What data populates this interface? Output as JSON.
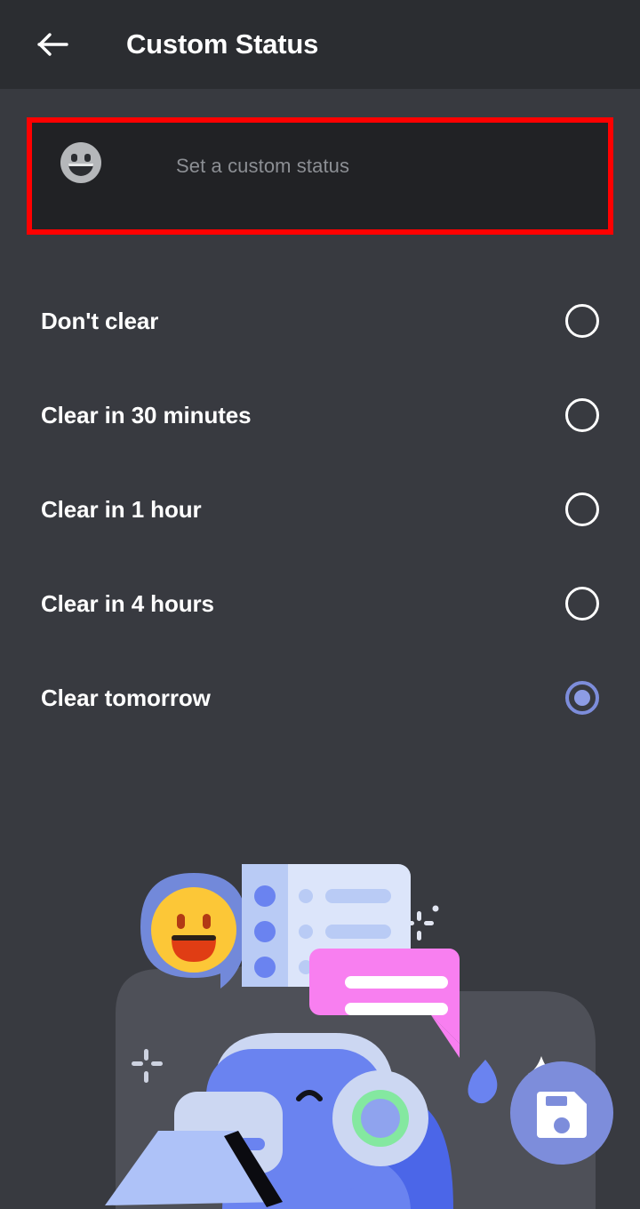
{
  "header": {
    "title": "Custom Status",
    "back_icon": "arrow-left-icon"
  },
  "status_input": {
    "placeholder": "Set a custom status",
    "value": "",
    "emoji_icon": "grinning-face-icon",
    "highlight_color": "#ff0000",
    "background_color": "#212225"
  },
  "clear_after": {
    "selected": "Clear tomorrow",
    "options": [
      {
        "label": "Don't clear",
        "selected": false
      },
      {
        "label": "Clear in 30 minutes",
        "selected": false
      },
      {
        "label": "Clear in 1 hour",
        "selected": false
      },
      {
        "label": "Clear in 4 hours",
        "selected": false
      },
      {
        "label": "Clear tomorrow",
        "selected": true
      }
    ],
    "selected_color": "#7d8ddb",
    "unselected_color": "#ffffff"
  },
  "illustration": {
    "name": "wumpus-custom-status-illustration",
    "elements": [
      "emoji-pin-icon",
      "list-card-icon",
      "speech-bubble-icon",
      "wumpus-with-headset-icon",
      "laptop-icon",
      "sparkle-icon",
      "save-fab-button"
    ],
    "blob_color": "#4e5058",
    "accent_periwinkle": "#7289da",
    "accent_blue": "#6a83f0",
    "accent_pink": "#f87ff0",
    "accent_yellow": "#fcc737",
    "accent_green": "#84e8a0",
    "card_light": "#dae3f8",
    "card_mid": "#b9cbf5"
  },
  "save_button": {
    "icon": "save-disk-icon",
    "background_color": "#7d8ddb"
  },
  "theme": {
    "page_background": "#383a40",
    "header_background": "#2b2d31",
    "text_primary": "#ffffff",
    "text_muted": "#8c8f94"
  }
}
